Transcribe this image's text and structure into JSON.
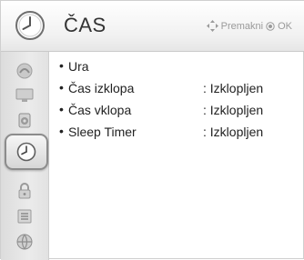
{
  "header": {
    "title": "ČAS",
    "hint_move": "Premakni",
    "hint_ok": "OK"
  },
  "sidebar": {
    "items": [
      {
        "icon": "picture-icon",
        "active": false
      },
      {
        "icon": "monitor-icon",
        "active": false
      },
      {
        "icon": "speaker-icon",
        "active": false
      },
      {
        "icon": "clock-icon",
        "active": true
      },
      {
        "icon": "lock-icon",
        "active": false
      },
      {
        "icon": "options-icon",
        "active": false
      },
      {
        "icon": "network-icon",
        "active": false
      }
    ]
  },
  "menu": {
    "items": [
      {
        "label": "Ura",
        "value": ""
      },
      {
        "label": "Čas izklopa",
        "value": ": Izklopljen"
      },
      {
        "label": "Čas vklopa",
        "value": ": Izklopljen"
      },
      {
        "label": "Sleep Timer",
        "value": ": Izklopljen"
      }
    ]
  },
  "colors": {
    "text": "#222222",
    "hint": "#9a9a9a",
    "active_border": "#8c8c8c"
  }
}
